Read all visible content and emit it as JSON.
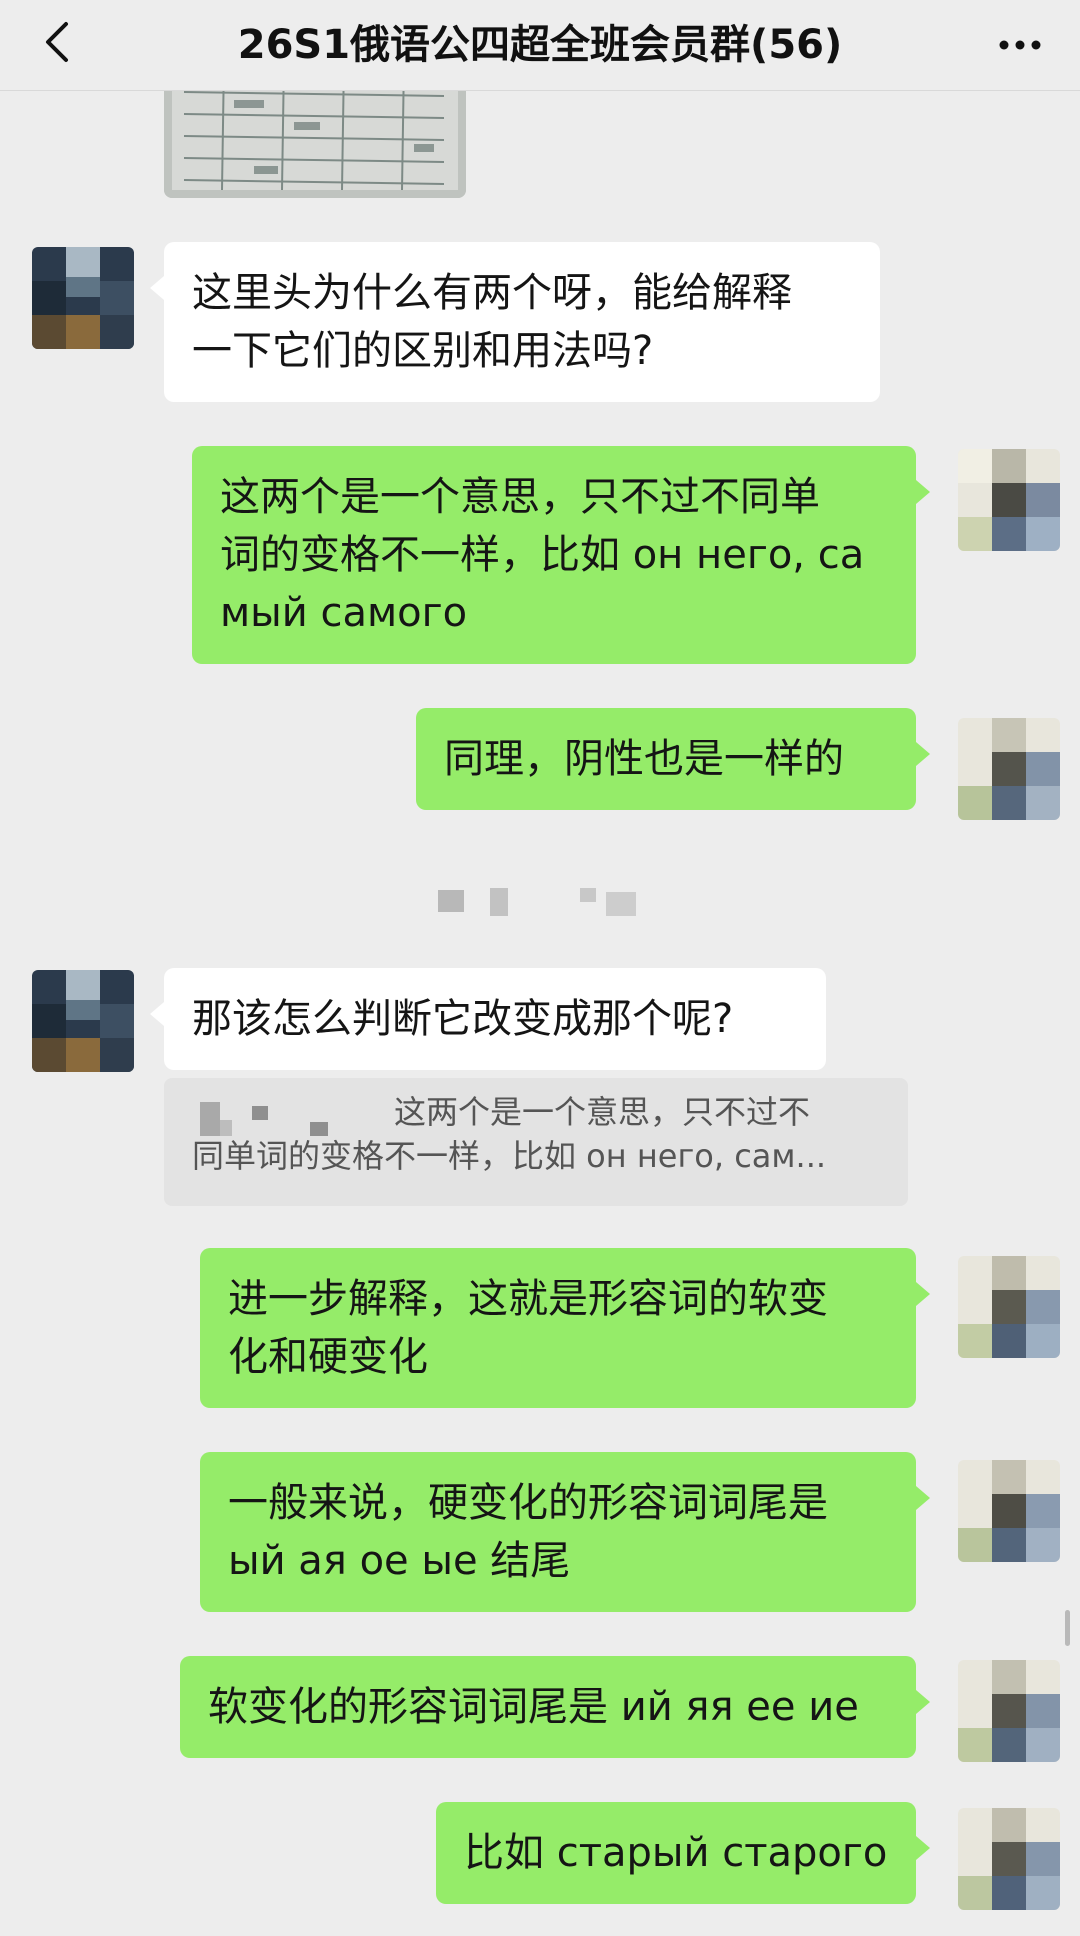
{
  "header": {
    "title": "26S1俄语公四超全班会员群(56)",
    "back_icon": "chevron-left-icon",
    "more_icon": "more-dots-icon"
  },
  "messages": [
    {
      "side": "left",
      "text": "这里头为什么有两个呀，能给解释\n一下它们的区别和用法吗?"
    },
    {
      "side": "right",
      "text": "这两个是一个意思，只不过不同单\n词的变格不一样，比如 он него, са\nмый самого"
    },
    {
      "side": "right",
      "text": "同理，阴性也是一样的"
    },
    {
      "side": "left",
      "text": "那该怎么判断它改变成那个呢?"
    },
    {
      "side": "right",
      "text": "进一步解释，这就是形容词的软变\n化和硬变化"
    },
    {
      "side": "right",
      "text": "一般来说，硬变化的形容词词尾是\nый ая ое ые 结尾"
    },
    {
      "side": "right",
      "text": "软变化的形容词词尾是 ий яя ее ие"
    },
    {
      "side": "right",
      "text": "比如 старый старого"
    }
  ],
  "quote": {
    "line1": "这两个是一个意思，只不过不",
    "line2": "同单词的变格不一样，比如 он него, сам..."
  },
  "colors": {
    "background": "#ededed",
    "sent_bubble": "#95ec69",
    "received_bubble": "#ffffff"
  }
}
